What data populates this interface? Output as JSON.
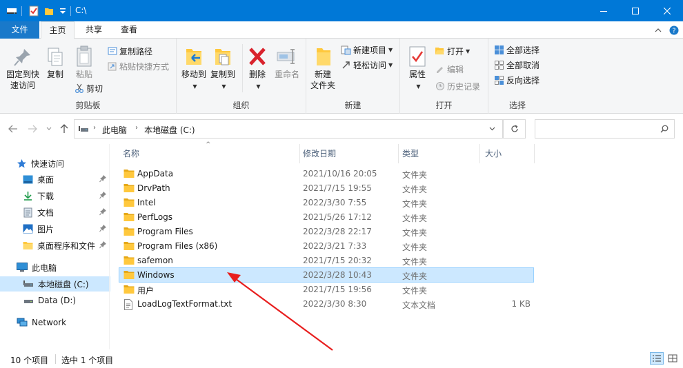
{
  "window": {
    "title": "C:\\"
  },
  "ribbon_tabs": [
    "文件",
    "主页",
    "共享",
    "查看"
  ],
  "ribbon": {
    "clipboard": {
      "label": "剪贴板",
      "pin_line1": "固定到快",
      "pin_line2": "速访问",
      "copy": "复制",
      "paste": "粘贴",
      "copy_path": "复制路径",
      "paste_shortcut": "粘贴快捷方式",
      "cut": "剪切"
    },
    "organize": {
      "label": "组织",
      "move_to": "移动到",
      "copy_to": "复制到",
      "delete": "删除",
      "rename": "重命名"
    },
    "new": {
      "label": "新建",
      "new_folder_line1": "新建",
      "new_folder_line2": "文件夹",
      "new_item": "新建项目",
      "easy_access": "轻松访问"
    },
    "open": {
      "label": "打开",
      "properties": "属性",
      "open": "打开",
      "edit": "编辑",
      "history": "历史记录"
    },
    "select": {
      "label": "选择",
      "select_all": "全部选择",
      "select_none": "全部取消",
      "invert": "反向选择"
    }
  },
  "address": {
    "segments": [
      "此电脑",
      "本地磁盘 (C:)"
    ]
  },
  "search": {
    "placeholder": ""
  },
  "nav_pane": {
    "quick_access": "快速访问",
    "quick_items": [
      "桌面",
      "下载",
      "文档",
      "图片",
      "桌面程序和文件"
    ],
    "this_pc": "此电脑",
    "drives": [
      "本地磁盘 (C:)",
      "Data (D:)"
    ],
    "network": "Network"
  },
  "columns": {
    "name": "名称",
    "date": "修改日期",
    "type": "类型",
    "size": "大小"
  },
  "files": [
    {
      "name": "AppData",
      "date": "2021/10/16 20:05",
      "type": "文件夹",
      "size": ""
    },
    {
      "name": "DrvPath",
      "date": "2021/7/15 19:55",
      "type": "文件夹",
      "size": ""
    },
    {
      "name": "Intel",
      "date": "2022/3/30 7:55",
      "type": "文件夹",
      "size": ""
    },
    {
      "name": "PerfLogs",
      "date": "2021/5/26 17:12",
      "type": "文件夹",
      "size": ""
    },
    {
      "name": "Program Files",
      "date": "2022/3/28 22:17",
      "type": "文件夹",
      "size": ""
    },
    {
      "name": "Program Files (x86)",
      "date": "2022/3/21 7:33",
      "type": "文件夹",
      "size": ""
    },
    {
      "name": "safemon",
      "date": "2021/7/15 20:32",
      "type": "文件夹",
      "size": ""
    },
    {
      "name": "Windows",
      "date": "2022/3/28 10:43",
      "type": "文件夹",
      "size": ""
    },
    {
      "name": "用户",
      "date": "2021/7/15 19:56",
      "type": "文件夹",
      "size": ""
    },
    {
      "name": "LoadLogTextFormat.txt",
      "date": "2022/3/30 8:30",
      "type": "文本文档",
      "size": "1 KB"
    }
  ],
  "status": {
    "count": "10 个项目",
    "selected": "选中 1 个项目"
  },
  "colors": {
    "titlebar": "#0078d7",
    "selection": "#cce8ff",
    "folder": "#ffc83d",
    "annotation_arrow": "#e81e1e"
  }
}
